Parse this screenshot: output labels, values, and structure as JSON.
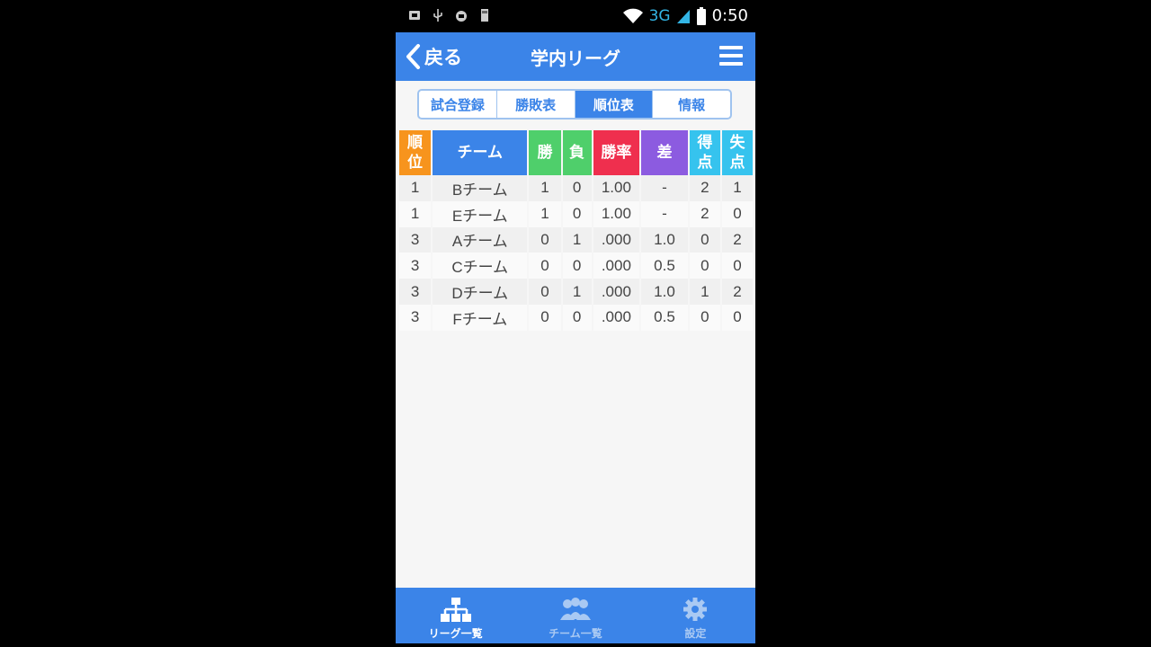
{
  "status_bar": {
    "network": "3G",
    "time": "0:50",
    "icons": [
      "notification-icon",
      "usb-icon",
      "android-icon",
      "sd-card-icon",
      "wifi-icon",
      "signal-icon",
      "battery-icon"
    ]
  },
  "app_bar": {
    "back_label": "戻る",
    "title": "学内リーグ",
    "menu_icon": "hamburger-menu-icon"
  },
  "tabs": [
    {
      "label": "試合登録",
      "active": false
    },
    {
      "label": "勝敗表",
      "active": false
    },
    {
      "label": "順位表",
      "active": true
    },
    {
      "label": "情報",
      "active": false
    }
  ],
  "standings": {
    "headers": {
      "rank": [
        "順",
        "位"
      ],
      "team": "チーム",
      "wins": "勝",
      "losses": "負",
      "win_pct": "勝率",
      "games_behind": "差",
      "goals_for": [
        "得",
        "点"
      ],
      "goals_against": [
        "失",
        "点"
      ]
    },
    "rows": [
      {
        "rank": "1",
        "team": "Bチーム",
        "wins": "1",
        "losses": "0",
        "win_pct": "1.00",
        "games_behind": "-",
        "goals_for": "2",
        "goals_against": "1"
      },
      {
        "rank": "1",
        "team": "Eチーム",
        "wins": "1",
        "losses": "0",
        "win_pct": "1.00",
        "games_behind": "-",
        "goals_for": "2",
        "goals_against": "0"
      },
      {
        "rank": "3",
        "team": "Aチーム",
        "wins": "0",
        "losses": "1",
        "win_pct": ".000",
        "games_behind": "1.0",
        "goals_for": "0",
        "goals_against": "2"
      },
      {
        "rank": "3",
        "team": "Cチーム",
        "wins": "0",
        "losses": "0",
        "win_pct": ".000",
        "games_behind": "0.5",
        "goals_for": "0",
        "goals_against": "0"
      },
      {
        "rank": "3",
        "team": "Dチーム",
        "wins": "0",
        "losses": "1",
        "win_pct": ".000",
        "games_behind": "1.0",
        "goals_for": "1",
        "goals_against": "2"
      },
      {
        "rank": "3",
        "team": "Fチーム",
        "wins": "0",
        "losses": "0",
        "win_pct": ".000",
        "games_behind": "0.5",
        "goals_for": "0",
        "goals_against": "0"
      }
    ]
  },
  "colors": {
    "primary": "#3b84e8",
    "rank_header": "#f7941d",
    "win_loss_header": "#4fcf6b",
    "pct_header": "#ef2f4e",
    "diff_header": "#8c5be0",
    "goals_header": "#36c3ee"
  },
  "bottom_nav": [
    {
      "label": "リーグ一覧",
      "icon": "league-tree-icon",
      "active": true
    },
    {
      "label": "チーム一覧",
      "icon": "team-people-icon",
      "active": false
    },
    {
      "label": "設定",
      "icon": "gear-icon",
      "active": false
    }
  ]
}
